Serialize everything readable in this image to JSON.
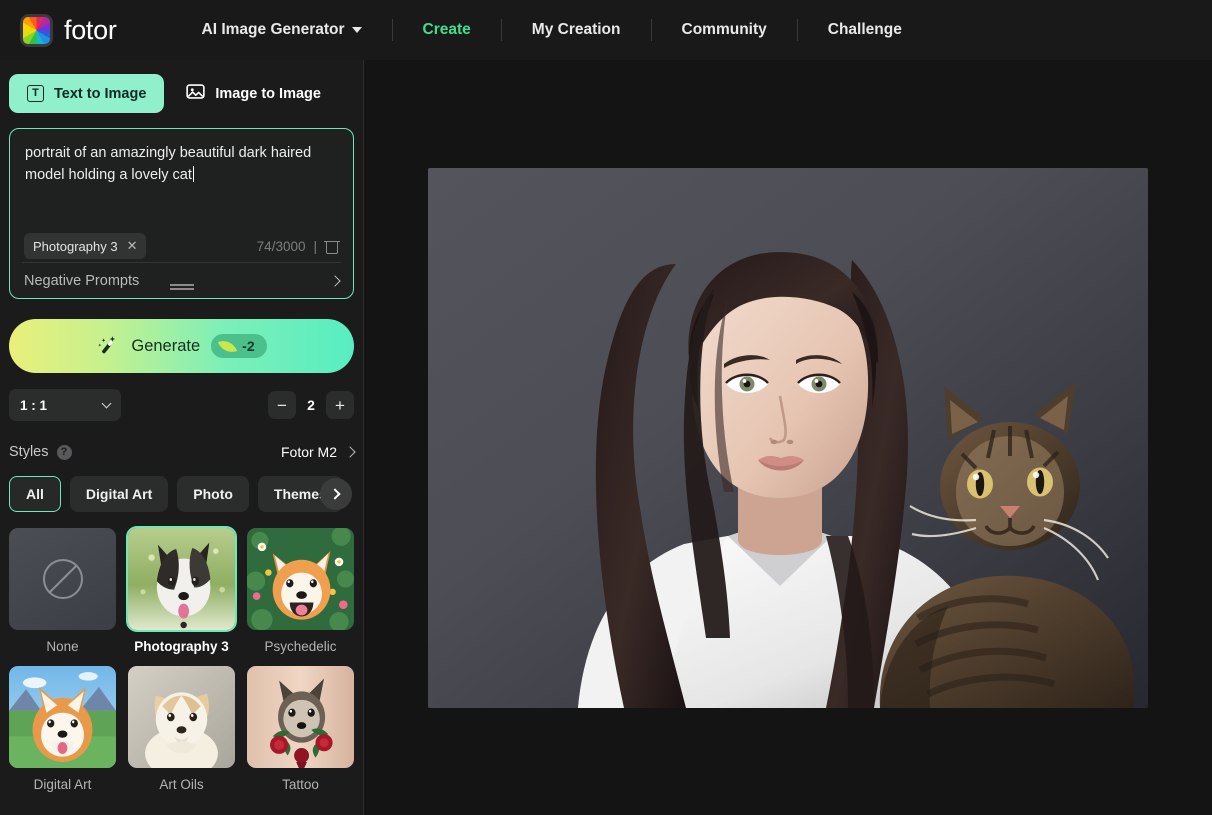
{
  "brand": {
    "name": "fotor",
    "logo_icon": "color-wheel-logo"
  },
  "nav": {
    "dropdown_label": "AI Image Generator",
    "items": [
      {
        "label": "Create",
        "active": true
      },
      {
        "label": "My Creation",
        "active": false
      },
      {
        "label": "Community",
        "active": false
      },
      {
        "label": "Challenge",
        "active": false
      }
    ]
  },
  "mode_tabs": [
    {
      "label": "Text to Image",
      "icon": "text-box-icon",
      "active": true
    },
    {
      "label": "Image to Image",
      "icon": "image-icon",
      "active": false
    }
  ],
  "prompt": {
    "value": "portrait of an amazingly beautiful dark haired model holding a lovely cat",
    "chip_label": "Photography 3",
    "chip_remove_icon": "close-icon",
    "char_count": "74/3000",
    "separator": "|",
    "trash_icon": "trash-icon",
    "negative_label": "Negative Prompts",
    "negative_chevron": "chevron-right-icon"
  },
  "generate": {
    "label": "Generate",
    "wand_icon": "magic-wand-icon",
    "credit_icon": "leaf-icon",
    "credit_cost": "-2",
    "gradient_from": "#e9f07a",
    "gradient_to": "#57eec1"
  },
  "options": {
    "ratio_value": "1 : 1",
    "ratio_chevron": "chevron-down-icon",
    "decrement_label": "−",
    "count_value": "2",
    "increment_label": "+"
  },
  "styles_header": {
    "title": "Styles",
    "help_icon": "question-mark-icon",
    "help_glyph": "?",
    "model_name": "Fotor M2",
    "model_chevron": "chevron-right-icon"
  },
  "categories": [
    {
      "label": "All",
      "active": true
    },
    {
      "label": "Digital Art",
      "active": false
    },
    {
      "label": "Photo",
      "active": false
    },
    {
      "label": "Themes",
      "active": false
    }
  ],
  "category_next_icon": "chevron-right-icon",
  "style_items": [
    {
      "label": "None",
      "selected": false,
      "kind": "none"
    },
    {
      "label": "Photography 3",
      "selected": true,
      "kind": "photo-dog"
    },
    {
      "label": "Psychedelic",
      "selected": false,
      "kind": "psychedelic-shiba"
    },
    {
      "label": "Digital Art",
      "selected": false,
      "kind": "digital-shiba"
    },
    {
      "label": "Art Oils",
      "selected": false,
      "kind": "oil-puppy"
    },
    {
      "label": "Tattoo",
      "selected": false,
      "kind": "tattoo-dog"
    }
  ],
  "result": {
    "alt": "AI generated portrait of a dark haired model holding a tabby cat"
  },
  "colors": {
    "accent_mint": "#6ee7b7",
    "accent_green": "#3ee08f",
    "page_bg": "#111111",
    "nav_bg": "#191919",
    "sidebar_bg": "#1b1b1b",
    "canvas_bg": "#141414"
  }
}
